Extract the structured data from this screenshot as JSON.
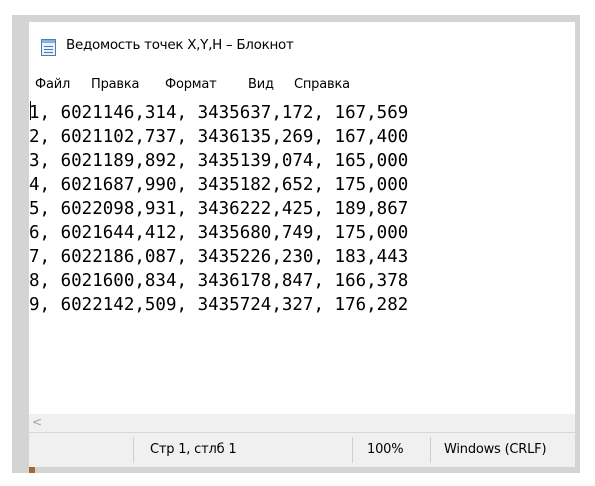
{
  "window": {
    "title": "Ведомость точек X,Y,H – Блокнот"
  },
  "menu": {
    "file": "Файл",
    "edit": "Правка",
    "format": "Формат",
    "view": "Вид",
    "help": "Справка"
  },
  "editor": {
    "lines": [
      "1, 6021146,314, 3435637,172, 167,569",
      "2, 6021102,737, 3436135,269, 167,400",
      "3, 6021189,892, 3435139,074, 165,000",
      "4, 6021687,990, 3435182,652, 175,000",
      "5, 6022098,931, 3436222,425, 189,867",
      "6, 6021644,412, 3435680,749, 175,000",
      "7, 6022186,087, 3435226,230, 183,443",
      "8, 6021600,834, 3436178,847, 166,378",
      "9, 6022142,509, 3435724,327, 176,282"
    ]
  },
  "scrollbar": {
    "left_arrow": "<"
  },
  "status": {
    "position": "Стр 1, стлб 1",
    "zoom": "100%",
    "line_ending": "Windows (CRLF)"
  },
  "icons": {
    "app": "notepad-icon",
    "scroll_left": "chevron-left-icon"
  }
}
